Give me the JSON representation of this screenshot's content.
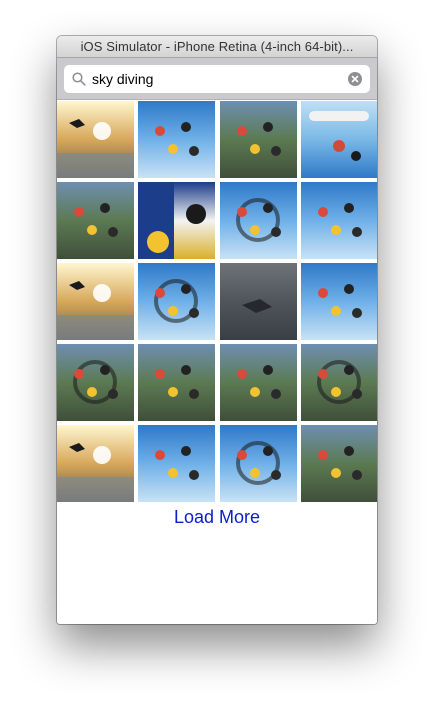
{
  "window": {
    "title": "iOS Simulator - iPhone Retina (4-inch 64-bit)..."
  },
  "search": {
    "query": "sky diving",
    "icon": "search-icon",
    "clear_icon": "clear-icon"
  },
  "photos": [
    {
      "scene": "sunset",
      "label": "skydiver over clouds at sunset"
    },
    {
      "scene": "sky",
      "label": "tandem skydivers"
    },
    {
      "scene": "ground",
      "label": "freefall group over land"
    },
    {
      "scene": "plane",
      "label": "skydivers exiting plane"
    },
    {
      "scene": "ground",
      "label": "formation circle over island"
    },
    {
      "scene": "ad",
      "label": "skydiving gift certificate promo"
    },
    {
      "scene": "sky",
      "label": "ring formation over earth"
    },
    {
      "scene": "sky",
      "label": "freefall pair in blue sky"
    },
    {
      "scene": "sunset",
      "label": "silhouette skydiver against sun"
    },
    {
      "scene": "sky",
      "label": "skydivers near plane in blue sky"
    },
    {
      "scene": "dark",
      "label": "skydiver in grey sky"
    },
    {
      "scene": "sky",
      "label": "skydiver close-up"
    },
    {
      "scene": "ground",
      "label": "large formation over ground"
    },
    {
      "scene": "ground",
      "label": "big formation over coastline"
    },
    {
      "scene": "ground",
      "label": "formation over fields"
    },
    {
      "scene": "ground",
      "label": "colorful skydivers over land"
    },
    {
      "scene": "sunset",
      "label": "skydiver over clouds at sunset"
    },
    {
      "scene": "sky",
      "label": "red skydiver in freefall"
    },
    {
      "scene": "sky",
      "label": "ring formation over earth"
    },
    {
      "scene": "ground",
      "label": "tandem jump with drogue"
    }
  ],
  "footer": {
    "load_more": "Load More"
  },
  "colors": {
    "accent": "#0a1ed0",
    "searchbar": "#c9c9ce"
  }
}
